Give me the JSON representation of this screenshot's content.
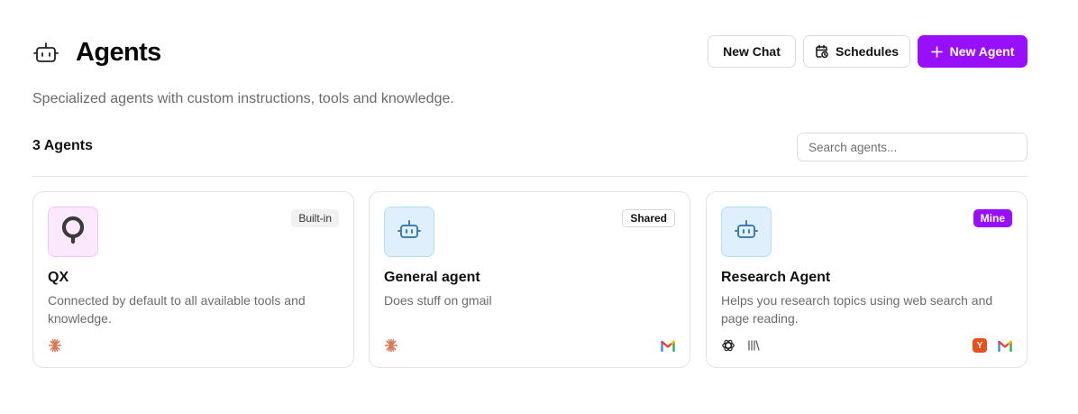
{
  "header": {
    "title": "Agents",
    "title_icon": "bot-icon",
    "buttons": {
      "new_chat": "New Chat",
      "schedules": "Schedules",
      "new_agent": "New Agent"
    }
  },
  "subtitle": "Specialized agents with custom instructions, tools and knowledge.",
  "agents_count": "3 Agents",
  "search": {
    "placeholder": "Search agents...",
    "value": ""
  },
  "colors": {
    "accent": "#9810fa",
    "pink_tile": "#fbe8fd",
    "blue_tile": "#dff0fc",
    "claude_orange": "#d97757",
    "youtube_orange": "#e8501b"
  },
  "agents": [
    {
      "name": "QX",
      "badge": "Built-in",
      "description": "Connected by default to all available tools and knowledge.",
      "avatar_icon": "qx-logo-icon",
      "tools": [
        "claude-icon"
      ]
    },
    {
      "name": "General agent",
      "badge": "Shared",
      "description": "Does stuff on gmail",
      "avatar_icon": "bot-icon",
      "tools": [
        "claude-icon",
        "gmail-icon"
      ]
    },
    {
      "name": "Research Agent",
      "badge": "Mine",
      "description": "Helps you research topics using web search and page reading.",
      "avatar_icon": "bot-icon",
      "tools": [
        "openai-icon",
        "library-icon",
        "y-icon",
        "gmail-icon"
      ],
      "y_icon_letter": "Y"
    }
  ]
}
